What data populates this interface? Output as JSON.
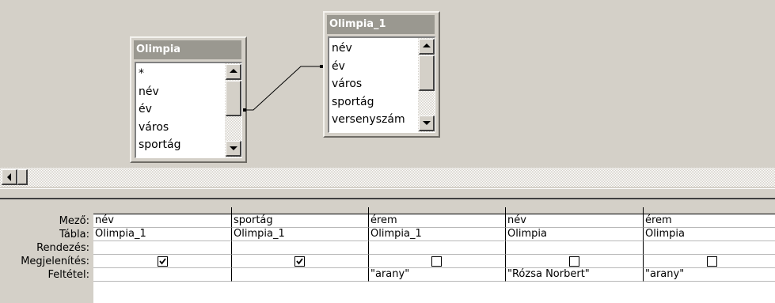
{
  "tables": [
    {
      "title": "Olimpia",
      "fields": [
        "*",
        "név",
        "év",
        "város",
        "sportág"
      ]
    },
    {
      "title": "Olimpia_1",
      "fields": [
        "név",
        "év",
        "város",
        "sportág",
        "versenyszám"
      ]
    }
  ],
  "grid": {
    "row_labels": [
      "Mező:",
      "Tábla:",
      "Rendezés:",
      "Megjelenítés:",
      "Feltétel:"
    ],
    "columns": [
      {
        "field": "név",
        "table": "Olimpia_1",
        "sort": "",
        "show": true,
        "criteria": ""
      },
      {
        "field": "sportág",
        "table": "Olimpia_1",
        "sort": "",
        "show": true,
        "criteria": ""
      },
      {
        "field": "érem",
        "table": "Olimpia_1",
        "sort": "",
        "show": false,
        "criteria": "\"arany\""
      },
      {
        "field": "név",
        "table": "Olimpia",
        "sort": "",
        "show": false,
        "criteria": "\"Rózsa Norbert\""
      },
      {
        "field": "érem",
        "table": "Olimpia",
        "sort": "",
        "show": false,
        "criteria": "\"arany\""
      }
    ]
  }
}
